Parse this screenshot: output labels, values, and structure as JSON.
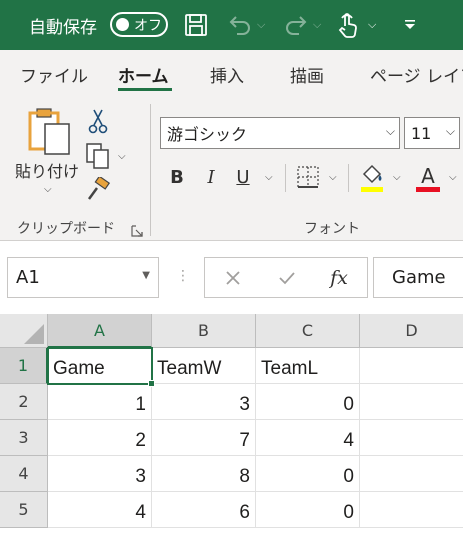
{
  "titlebar": {
    "autosave_label": "自動保存",
    "autosave_state": "オフ",
    "bg_color": "#217346",
    "icons": [
      "save-icon",
      "undo-icon",
      "redo-icon",
      "touch-mode-icon",
      "customize-toolbar-icon"
    ]
  },
  "tabs": [
    {
      "label": "ファイル",
      "active": false
    },
    {
      "label": "ホーム",
      "active": true
    },
    {
      "label": "挿入",
      "active": false
    },
    {
      "label": "描画",
      "active": false
    },
    {
      "label": "ページ レイア",
      "active": false
    }
  ],
  "ribbon": {
    "clipboard": {
      "paste_label": "貼り付け",
      "group_label": "クリップボード"
    },
    "font": {
      "font_name": "游ゴシック",
      "font_size": "11",
      "group_label": "フォント",
      "bold": "B",
      "italic": "I",
      "underline": "U",
      "font_color_letter": "A",
      "highlight_color": "#ffff00",
      "font_color": "#e81123"
    }
  },
  "formula_bar": {
    "name_box": "A1",
    "formula": "Game"
  },
  "sheet": {
    "columns": [
      "A",
      "B",
      "C",
      "D"
    ],
    "rows": [
      "1",
      "2",
      "3",
      "4",
      "5"
    ],
    "selected_cell": "A1",
    "cells": [
      [
        "Game",
        "TeamW",
        "TeamL",
        ""
      ],
      [
        "1",
        "3",
        "0",
        ""
      ],
      [
        "2",
        "7",
        "4",
        ""
      ],
      [
        "3",
        "8",
        "0",
        ""
      ],
      [
        "4",
        "6",
        "0",
        ""
      ]
    ]
  }
}
